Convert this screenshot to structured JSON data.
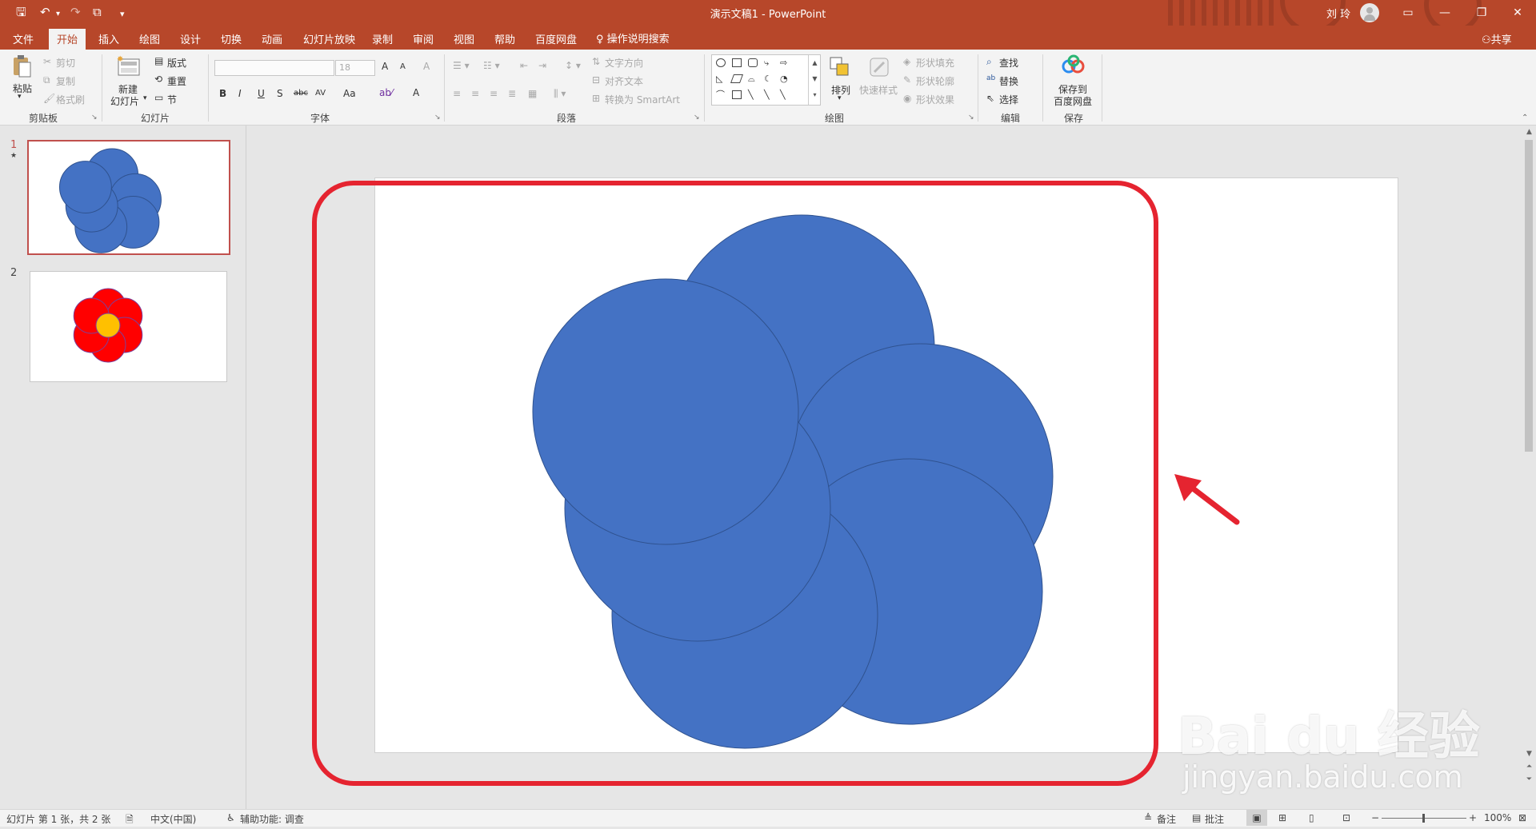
{
  "window": {
    "title": "演示文稿1  -  PowerPoint",
    "user": "刘 玲",
    "controls": {
      "ribbon_display": "▭",
      "minimize": "—",
      "restore": "❐",
      "close": "✕"
    }
  },
  "quick_access": {
    "save": "🖫",
    "undo": "↶",
    "redo": "↷",
    "present": "⧉",
    "customize": "▾"
  },
  "tabs": [
    {
      "label": "文件"
    },
    {
      "label": "开始"
    },
    {
      "label": "插入"
    },
    {
      "label": "绘图"
    },
    {
      "label": "设计"
    },
    {
      "label": "切换"
    },
    {
      "label": "动画"
    },
    {
      "label": "幻灯片放映"
    },
    {
      "label": "录制"
    },
    {
      "label": "审阅"
    },
    {
      "label": "视图"
    },
    {
      "label": "帮助"
    },
    {
      "label": "百度网盘"
    }
  ],
  "active_tab": "开始",
  "tell_me": "操作说明搜索",
  "share": "共享",
  "ribbon": {
    "clipboard": {
      "label": "剪贴板",
      "paste": "粘贴",
      "cut": "剪切",
      "copy": "复制",
      "format_painter": "格式刷"
    },
    "slides": {
      "label": "幻灯片",
      "new_slide_line1": "新建",
      "new_slide_line2": "幻灯片",
      "layout": "版式",
      "reset": "重置",
      "section": "节"
    },
    "font": {
      "label": "字体",
      "font_name": "",
      "font_size": "18",
      "bold": "B",
      "italic": "I",
      "underline": "U",
      "shadow": "S",
      "strike": "abc",
      "spacing": "AV",
      "case": "Aa",
      "grow": "A",
      "shrink": "A",
      "clear": "A",
      "color": "A"
    },
    "paragraph": {
      "label": "段落",
      "text_direction": "文字方向",
      "align_text": "对齐文本",
      "smartart": "转换为 SmartArt"
    },
    "drawing": {
      "label": "绘图",
      "arrange": "排列",
      "quick_styles": "快速样式",
      "shape_fill": "形状填充",
      "shape_outline": "形状轮廓",
      "shape_effects": "形状效果"
    },
    "editing": {
      "label": "编辑",
      "find": "查找",
      "replace": "替换",
      "select": "选择"
    },
    "save": {
      "label": "保存",
      "save_to_line1": "保存到",
      "save_to_line2": "百度网盘"
    }
  },
  "thumbnails": [
    {
      "number": "1",
      "star": "★",
      "selected": true
    },
    {
      "number": "2",
      "selected": false
    }
  ],
  "colors": {
    "accent": "#b7472a",
    "circle_fill": "#4472c4",
    "circle_stroke": "#2f528f",
    "flower_petal": "#ff0000",
    "flower_center": "#ffc000",
    "annotation": "#e52430"
  },
  "watermark": {
    "line1": "Bai du 经验",
    "line2": "jingyan.baidu.com"
  },
  "statusbar": {
    "slide_info": "幻灯片 第 1 张，共 2 张",
    "language": "中文(中国)",
    "accessibility": "辅助功能: 调查",
    "notes": "备注",
    "comments": "批注",
    "zoom": "100%"
  }
}
